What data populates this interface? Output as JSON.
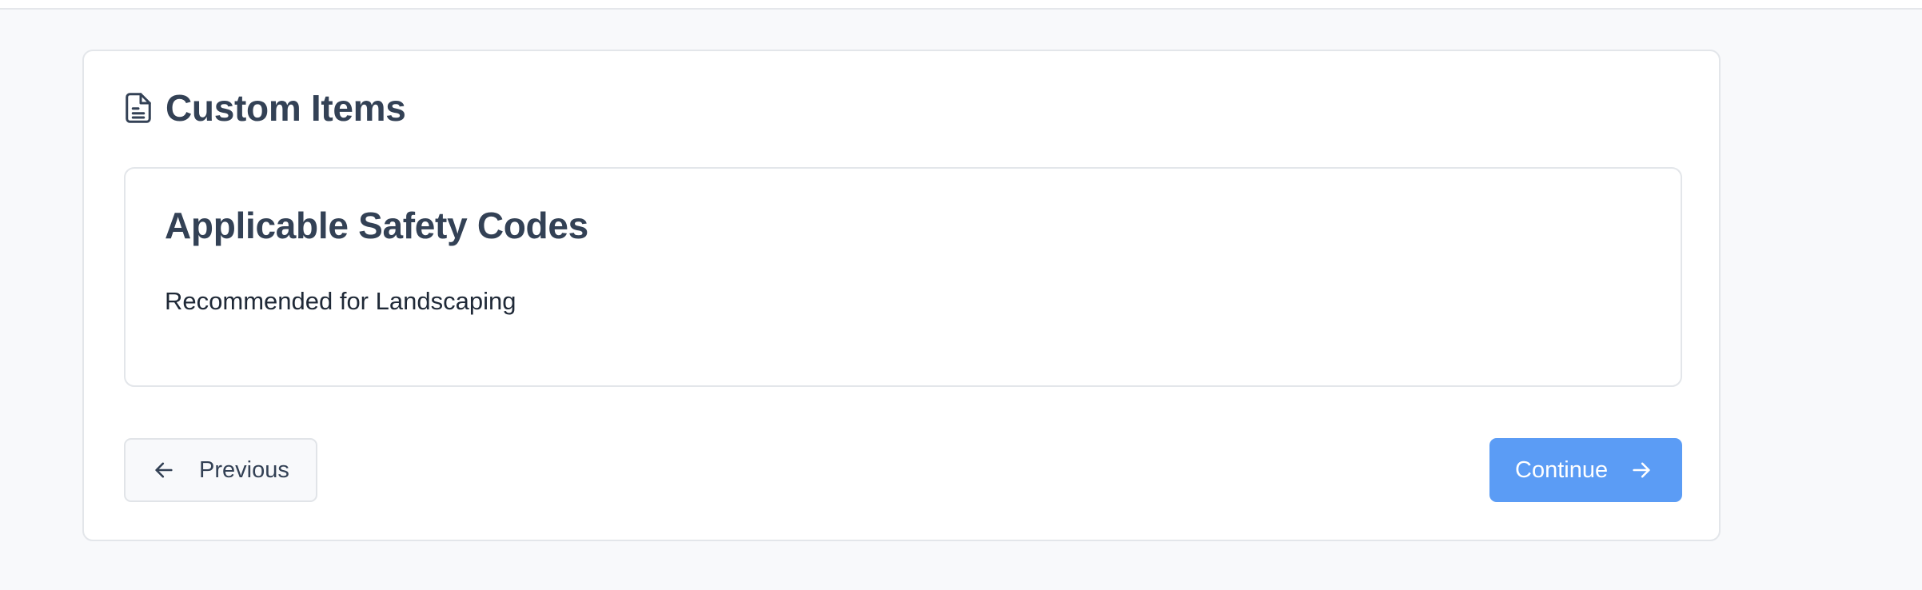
{
  "card": {
    "title": "Custom Items",
    "icon": "document-icon"
  },
  "section": {
    "title": "Applicable Safety Codes",
    "text": "Recommended for Landscaping"
  },
  "navigation": {
    "previous_label": "Previous",
    "continue_label": "Continue",
    "previous_icon": "arrow-left-icon",
    "continue_icon": "arrow-right-icon"
  },
  "colors": {
    "accent": "#5b9cf5",
    "heading": "#334155",
    "background": "#f8f9fb"
  }
}
